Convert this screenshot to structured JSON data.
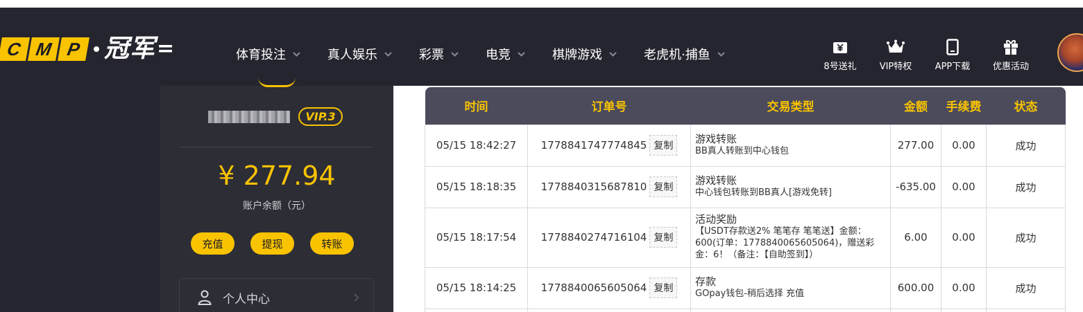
{
  "logo": {
    "letters": [
      "C",
      "M",
      "P"
    ],
    "cn": "冠军",
    "tail": "="
  },
  "nav": {
    "menu": [
      {
        "label": "体育投注"
      },
      {
        "label": "真人娱乐"
      },
      {
        "label": "彩票"
      },
      {
        "label": "电竞"
      },
      {
        "label": "棋牌游戏"
      },
      {
        "label": "老虎机·捕鱼"
      }
    ],
    "tools": [
      {
        "label": "8号送礼",
        "icon": "yen-gift-icon"
      },
      {
        "label": "VIP特权",
        "icon": "crown-icon"
      },
      {
        "label": "APP下载",
        "icon": "tablet-icon"
      },
      {
        "label": "优惠活动",
        "icon": "gift-icon"
      }
    ]
  },
  "account": {
    "username": "****",
    "vip": "VIP.3",
    "balance": "¥ 277.94",
    "balance_label": "账户余额（元）",
    "actions": [
      "充值",
      "提现",
      "转账"
    ],
    "menu_item": "个人中心"
  },
  "table": {
    "headers": [
      "时间",
      "订单号",
      "交易类型",
      "金额",
      "手续费",
      "状态"
    ],
    "copy_label": "复制",
    "rows": [
      {
        "time": "05/15 18:42:27",
        "order": "1778841747774845",
        "type": "游戏转账",
        "detail": "BB真人转账到中心钱包",
        "amount": "277.00",
        "fee": "0.00",
        "status": "成功"
      },
      {
        "time": "05/15 18:18:35",
        "order": "1778840315687810",
        "type": "游戏转账",
        "detail": "中心钱包转账到BB真人[游戏免转]",
        "amount": "-635.00",
        "fee": "0.00",
        "status": "成功"
      },
      {
        "time": "05/15 18:17:54",
        "order": "1778840274716104",
        "type": "活动奖励",
        "detail": "【USDT存款送2% 笔笔存 笔笔送】金额：600(订单：1778840065605064)，赠送彩金：6！（备注：【自助签到】）",
        "amount": "6.00",
        "fee": "0.00",
        "status": "成功"
      },
      {
        "time": "05/15 18:14:25",
        "order": "1778840065605064",
        "type": "存款",
        "detail": "GOpay钱包-稍后选择 充值",
        "amount": "600.00",
        "fee": "0.00",
        "status": "成功"
      }
    ]
  },
  "colors": {
    "accent": "#f9c300",
    "nav_bg": "#25252f",
    "header_bg": "#4b4b5c",
    "success": "#3aa33a"
  }
}
